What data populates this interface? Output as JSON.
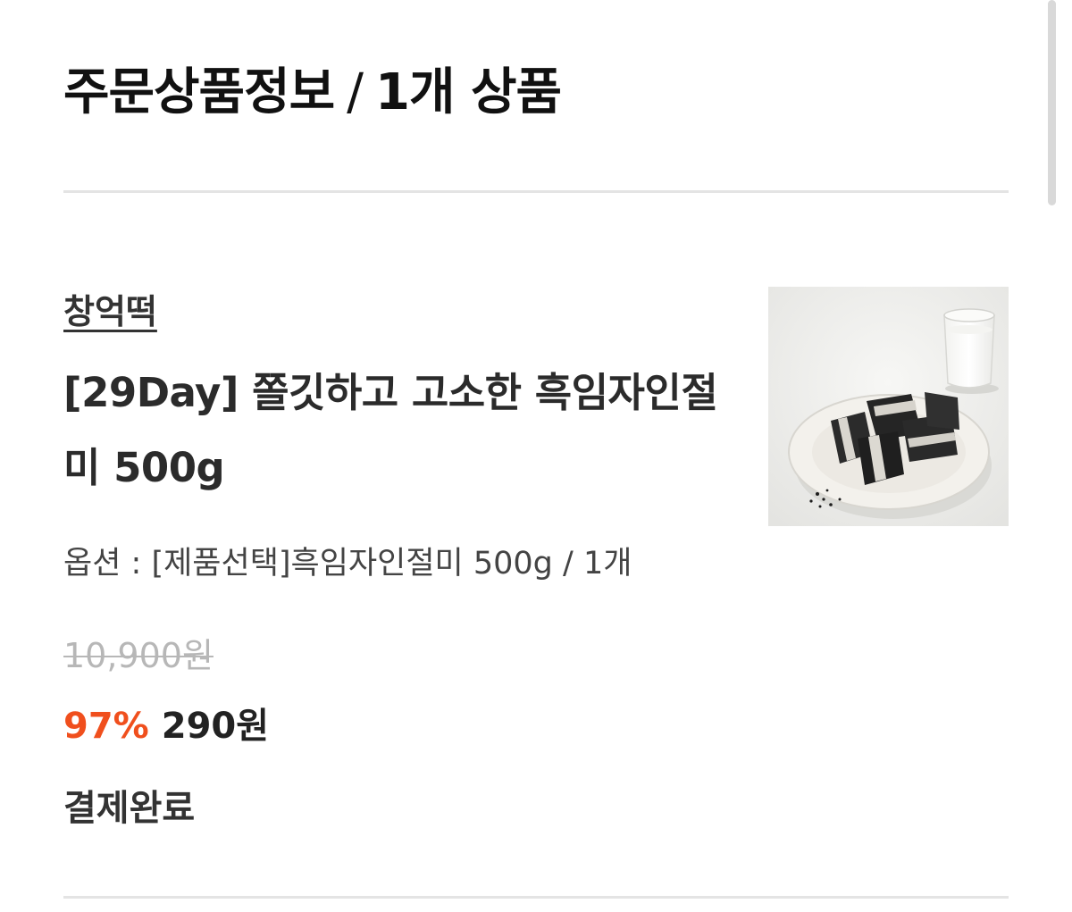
{
  "section": {
    "title": "주문상품정보",
    "separator": "/",
    "count_label": "1개 상품"
  },
  "product": {
    "brand": "창억떡",
    "title": "[29Day] 쫄깃하고 고소한 흑임자인절미 500g",
    "option_text": "옵션 : [제품선택]흑임자인절미 500g / 1개",
    "original_price": "10,900원",
    "discount_rate": "97%",
    "sale_price": "290원",
    "status": "결제완료",
    "image_icon": "product-photo-black-sesame-rice-cake"
  },
  "colors": {
    "discount": "#f04f1d",
    "text": "#222222",
    "muted": "#b7b7b7",
    "divider": "#e4e4e4"
  }
}
